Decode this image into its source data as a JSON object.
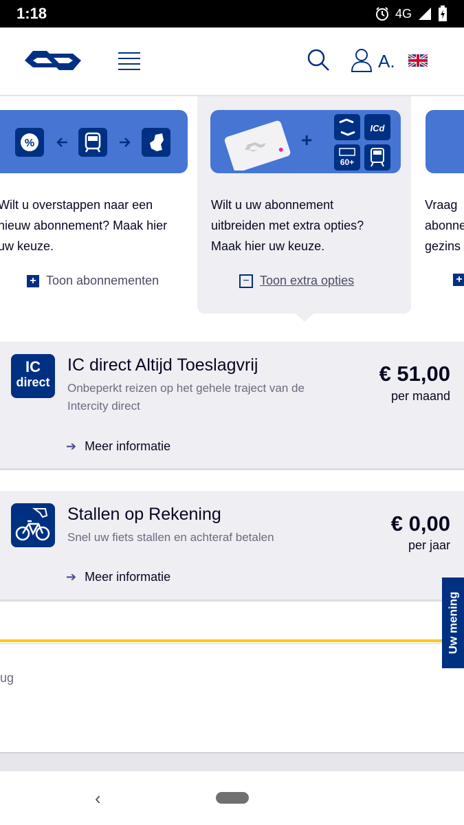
{
  "status_bar": {
    "time": "1:18",
    "network": "4G"
  },
  "header": {
    "user_label": "A."
  },
  "cards": [
    {
      "text_lines": [
        "Wilt u overstappen naar een",
        "nieuw abonnement? Maak hier",
        "uw keuze."
      ],
      "link": "Toon abonnementen"
    },
    {
      "text_lines": [
        "Wilt u uw abonnement",
        "uitbreiden met extra opties?",
        "Maak hier uw keuze."
      ],
      "link": "Toon extra opties"
    },
    {
      "text_lines": [
        "Vraag",
        "abonne",
        "gezins"
      ],
      "link": ""
    }
  ],
  "products": [
    {
      "icon_text_1": "IC",
      "icon_text_2": "direct",
      "title": "IC direct Altijd Toeslagvrij",
      "description": "Onbeperkt reizen op het gehele traject van de Intercity direct",
      "price": "€ 51,00",
      "period": "per maand",
      "more": "Meer informatie"
    },
    {
      "title": "Stallen op Rekening",
      "description": "Snel uw fiets stallen en achteraf betalen",
      "price": "€ 0,00",
      "period": "per jaar",
      "more": "Meer informatie"
    }
  ],
  "partial_text": "ug",
  "feedback_label": "Uw mening",
  "icon_badges": {
    "icd": "ICd",
    "age": "60+"
  },
  "colors": {
    "brand_blue": "#003082",
    "banner_blue": "#4675d4",
    "accent_yellow": "#ffc917"
  }
}
